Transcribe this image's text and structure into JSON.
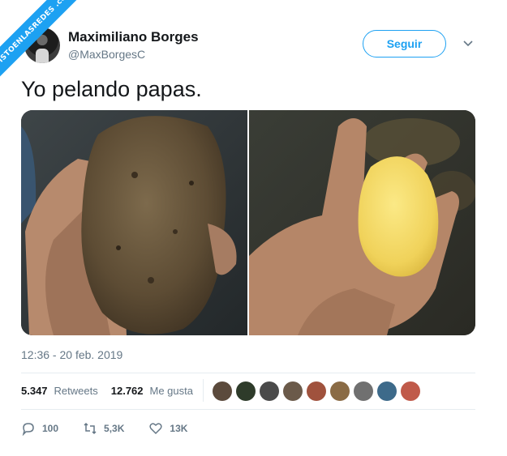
{
  "watermark": "VISTOENLASREDES .com",
  "author": {
    "name": "Maximiliano Borges",
    "handle": "@MaxBorgesC"
  },
  "follow_label": "Seguir",
  "tweet_text": "Yo pelando papas.",
  "timestamp": "12:36 - 20 feb. 2019",
  "stats": {
    "retweets_count": "5.347",
    "retweets_label": "Retweets",
    "likes_count": "12.762",
    "likes_label": "Me gusta"
  },
  "actions": {
    "replies": "100",
    "retweets": "5,3K",
    "likes": "13K"
  },
  "colors": {
    "accent": "#1da1f2",
    "muted": "#657786",
    "text": "#14171a"
  },
  "liker_avatars": [
    "#5b4a3c",
    "#2e3b2a",
    "#4a4a4a",
    "#6b5a4a",
    "#a0523d",
    "#8a6b45",
    "#707070",
    "#3d6a8a",
    "#c05a4a"
  ]
}
